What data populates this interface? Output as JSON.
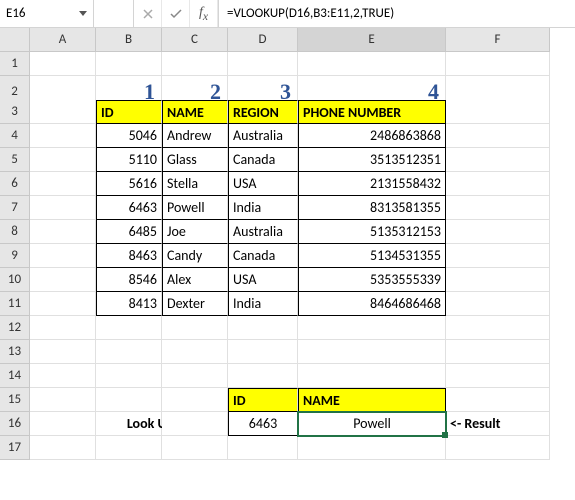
{
  "name_box": "E16",
  "formula": "=VLOOKUP(D16,B3:E11,2,TRUE)",
  "col_headers": [
    "A",
    "B",
    "C",
    "D",
    "E",
    "F"
  ],
  "row_headers": [
    "1",
    "2",
    "3",
    "4",
    "5",
    "6",
    "7",
    "8",
    "9",
    "10",
    "11",
    "12",
    "13",
    "14",
    "15",
    "16",
    "17"
  ],
  "col_numbers": [
    "1",
    "2",
    "3",
    "4"
  ],
  "table_head": {
    "id": "ID",
    "name": "NAME",
    "region": "REGION",
    "phone": "PHONE NUMBER"
  },
  "table": [
    {
      "id": "5046",
      "name": "Andrew",
      "region": "Australia",
      "phone": "2486863868"
    },
    {
      "id": "5110",
      "name": "Glass",
      "region": "Canada",
      "phone": "3513512351"
    },
    {
      "id": "5616",
      "name": "Stella",
      "region": "USA",
      "phone": "2131558432"
    },
    {
      "id": "6463",
      "name": "Powell",
      "region": "India",
      "phone": "8313581355"
    },
    {
      "id": "6485",
      "name": "Joe",
      "region": "Australia",
      "phone": "5135312153"
    },
    {
      "id": "8463",
      "name": "Candy",
      "region": "Canada",
      "phone": "5134531355"
    },
    {
      "id": "8546",
      "name": "Alex",
      "region": "USA",
      "phone": "5353555339"
    },
    {
      "id": "8413",
      "name": "Dexter",
      "region": "India",
      "phone": "8464686468"
    }
  ],
  "lookup": {
    "label": "Look Up Value->",
    "id_label": "ID",
    "name_label": "NAME",
    "id_value": "6463",
    "name_value": "Powell",
    "result_label": "<- Result"
  }
}
